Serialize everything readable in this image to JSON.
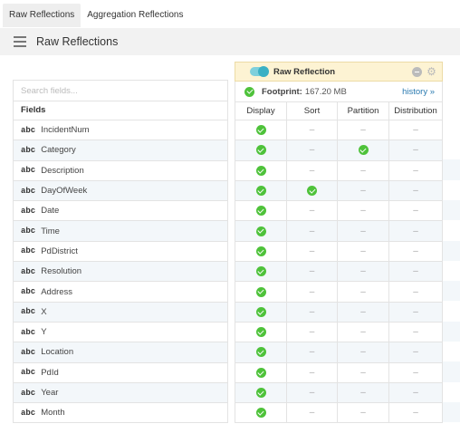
{
  "tabs": [
    {
      "label": "Raw Reflections",
      "active": true
    },
    {
      "label": "Aggregation Reflections",
      "active": false
    }
  ],
  "section": {
    "title": "Raw Reflections",
    "icon": "list-icon"
  },
  "fields_panel": {
    "search_placeholder": "Search fields...",
    "header": "Fields",
    "type_label": "abc",
    "fields": [
      "IncidentNum",
      "Category",
      "Description",
      "DayOfWeek",
      "Date",
      "Time",
      "PdDistrict",
      "Resolution",
      "Address",
      "X",
      "Y",
      "Location",
      "PdId",
      "Year",
      "Month"
    ]
  },
  "reflection": {
    "title": "Raw Reflection",
    "enabled": true,
    "footprint_label": "Footprint:",
    "footprint_value": "167.20 MB",
    "history_label": "history »",
    "columns": [
      "Display",
      "Sort",
      "Partition",
      "Distribution"
    ],
    "dash": "–",
    "rows": [
      {
        "display": true,
        "sort": false,
        "partition": false,
        "distribution": false
      },
      {
        "display": true,
        "sort": false,
        "partition": true,
        "distribution": false
      },
      {
        "display": true,
        "sort": false,
        "partition": false,
        "distribution": false
      },
      {
        "display": true,
        "sort": true,
        "partition": false,
        "distribution": false
      },
      {
        "display": true,
        "sort": false,
        "partition": false,
        "distribution": false
      },
      {
        "display": true,
        "sort": false,
        "partition": false,
        "distribution": false
      },
      {
        "display": true,
        "sort": false,
        "partition": false,
        "distribution": false
      },
      {
        "display": true,
        "sort": false,
        "partition": false,
        "distribution": false
      },
      {
        "display": true,
        "sort": false,
        "partition": false,
        "distribution": false
      },
      {
        "display": true,
        "sort": false,
        "partition": false,
        "distribution": false
      },
      {
        "display": true,
        "sort": false,
        "partition": false,
        "distribution": false
      },
      {
        "display": true,
        "sort": false,
        "partition": false,
        "distribution": false
      },
      {
        "display": true,
        "sort": false,
        "partition": false,
        "distribution": false
      },
      {
        "display": true,
        "sort": false,
        "partition": false,
        "distribution": false
      },
      {
        "display": true,
        "sort": false,
        "partition": false,
        "distribution": false
      }
    ]
  },
  "colors": {
    "accent": "#4ec23a",
    "link": "#2a7ab0",
    "toggle": "#3bb0c4",
    "header_bg": "#fdf3d3"
  }
}
